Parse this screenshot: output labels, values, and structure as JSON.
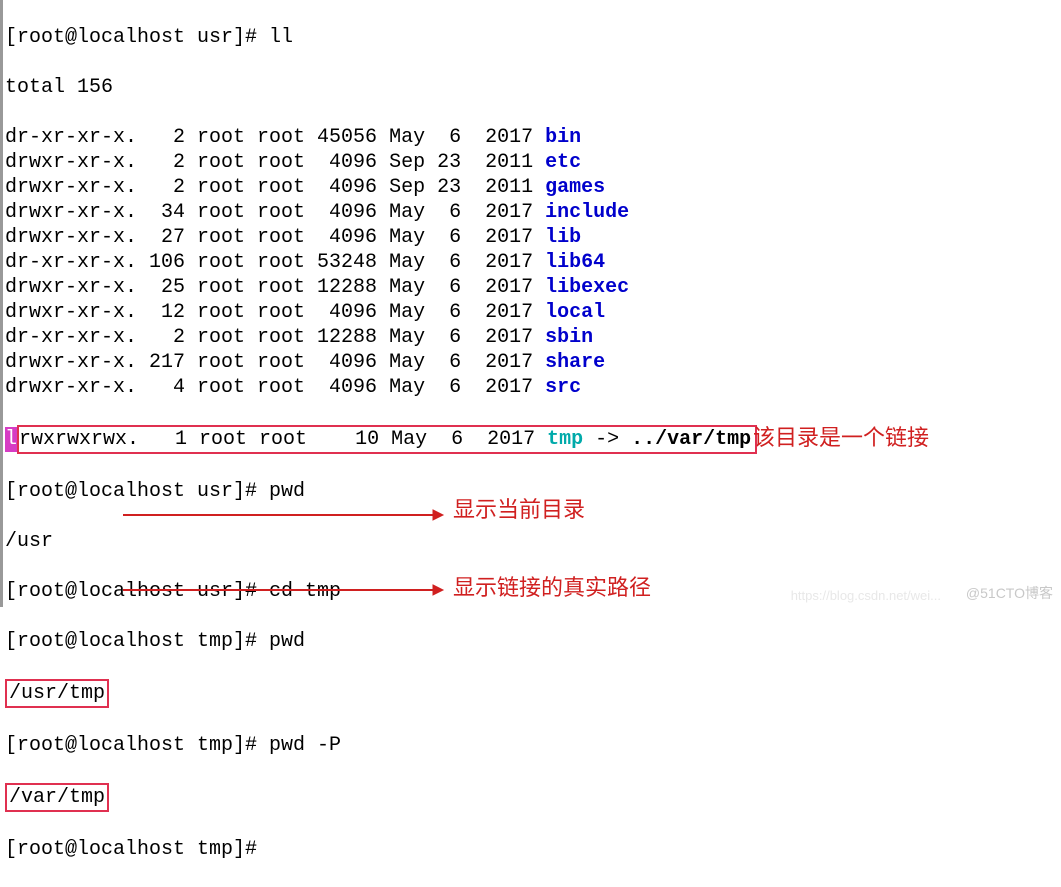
{
  "prompt1": "[root@localhost usr]# ll",
  "total": "total 156",
  "rows": [
    {
      "perm": "dr-xr-xr-x.",
      "lnk": "   2",
      "own": " root root",
      "size": " 45056",
      "date": " May  6  2017 ",
      "name": "bin",
      "cls": "blue"
    },
    {
      "perm": "drwxr-xr-x.",
      "lnk": "   2",
      "own": " root root",
      "size": "  4096",
      "date": " Sep 23  2011 ",
      "name": "etc",
      "cls": "blue"
    },
    {
      "perm": "drwxr-xr-x.",
      "lnk": "   2",
      "own": " root root",
      "size": "  4096",
      "date": " Sep 23  2011 ",
      "name": "games",
      "cls": "blue"
    },
    {
      "perm": "drwxr-xr-x.",
      "lnk": "  34",
      "own": " root root",
      "size": "  4096",
      "date": " May  6  2017 ",
      "name": "include",
      "cls": "blue"
    },
    {
      "perm": "drwxr-xr-x.",
      "lnk": "  27",
      "own": " root root",
      "size": "  4096",
      "date": " May  6  2017 ",
      "name": "lib",
      "cls": "blue"
    },
    {
      "perm": "dr-xr-xr-x.",
      "lnk": " 106",
      "own": " root root",
      "size": " 53248",
      "date": " May  6  2017 ",
      "name": "lib64",
      "cls": "blue"
    },
    {
      "perm": "drwxr-xr-x.",
      "lnk": "  25",
      "own": " root root",
      "size": " 12288",
      "date": " May  6  2017 ",
      "name": "libexec",
      "cls": "blue"
    },
    {
      "perm": "drwxr-xr-x.",
      "lnk": "  12",
      "own": " root root",
      "size": "  4096",
      "date": " May  6  2017 ",
      "name": "local",
      "cls": "blue"
    },
    {
      "perm": "dr-xr-xr-x.",
      "lnk": "   2",
      "own": " root root",
      "size": " 12288",
      "date": " May  6  2017 ",
      "name": "sbin",
      "cls": "blue"
    },
    {
      "perm": "drwxr-xr-x.",
      "lnk": " 217",
      "own": " root root",
      "size": "  4096",
      "date": " May  6  2017 ",
      "name": "share",
      "cls": "blue"
    },
    {
      "perm": "drwxr-xr-x.",
      "lnk": "   4",
      "own": " root root",
      "size": "  4096",
      "date": " May  6  2017 ",
      "name": "src",
      "cls": "blue"
    }
  ],
  "link_row": {
    "l": "l",
    "rest": "rwxrwxrwx.   1 root root    10 May  6  2017 ",
    "name": "tmp",
    "arrow": " -> ",
    "target": "../var/tmp"
  },
  "prompt2": "[root@localhost usr]# pwd",
  "pwd1": "/usr",
  "prompt3": "[root@localhost usr]# cd tmp",
  "prompt4": "[root@localhost tmp]# pwd",
  "pwd2": "/usr/tmp",
  "prompt5": "[root@localhost tmp]# pwd -P",
  "pwd3": "/var/tmp",
  "prompt6": "[root@localhost tmp]# ",
  "anno1": "该目录是一个链接",
  "anno2": "显示当前目录",
  "anno3": "显示链接的真实路径",
  "watermark": "@51CTO博客",
  "watermark2": "https://blog.csdn.net/wei..."
}
